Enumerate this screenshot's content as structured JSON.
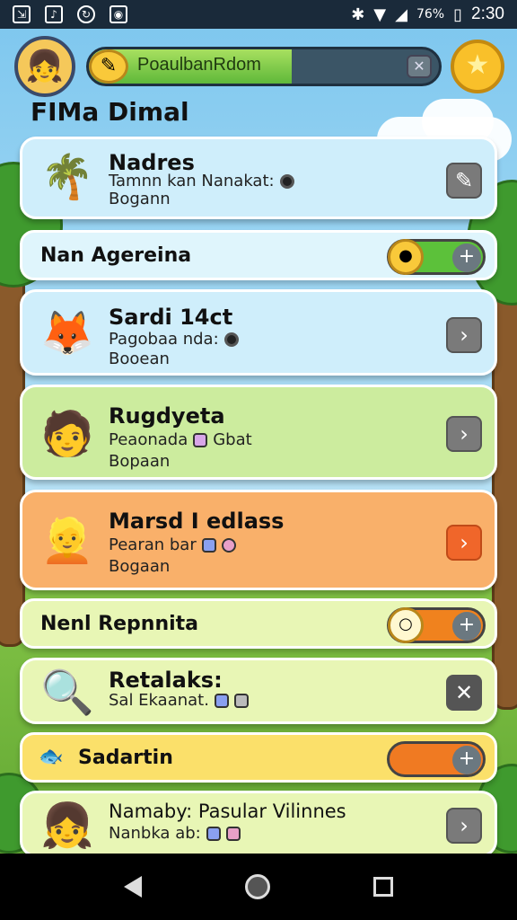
{
  "status_bar": {
    "time": "2:30",
    "battery": "76%"
  },
  "header": {
    "xp_label": "PoaulbanRdom",
    "xp_progress": 0.58,
    "close_glyph": "✕",
    "title": "FIMa Dimal"
  },
  "cards": [
    {
      "title": "Nadres",
      "line1": "Tamnn kan Nanakat:",
      "line2": "Bogann"
    },
    {
      "title": "Sardi 14ct",
      "line1": "Pagobaa nda:",
      "line2": "Booean"
    },
    {
      "title": "Rugdyeta",
      "line1": "Peaonada",
      "line1b": "Gbat",
      "line2": "Bopaan"
    },
    {
      "title": "Marsd I edlass",
      "line1": "Pearan bar",
      "line2": "Bogaan"
    },
    {
      "title": "Retalaks:",
      "line1": "Sal Ekaanat.",
      "line2": ""
    },
    {
      "title": "Namaby: Pasular Vilinnes",
      "line1": "Nanbka ab:",
      "line2": ""
    }
  ],
  "toggles": [
    {
      "label": "Nan Agereina",
      "state": "on",
      "color": "#5cc13a"
    },
    {
      "label": "Nenl Repnnita",
      "state": "on",
      "color": "#f0821e"
    },
    {
      "label": "Sadartin",
      "state": "off",
      "color": "#f07a22"
    }
  ],
  "colors": {
    "card_blue": "#cfeefb",
    "card_green": "#ccec9e",
    "card_orange": "#f9b06a",
    "card_lime": "#e8f6b5",
    "toggle_yellow": "#fbe06a"
  },
  "icons": {
    "avatar": "girl-avatar",
    "star": "star-icon",
    "xp": "coin-icon"
  }
}
